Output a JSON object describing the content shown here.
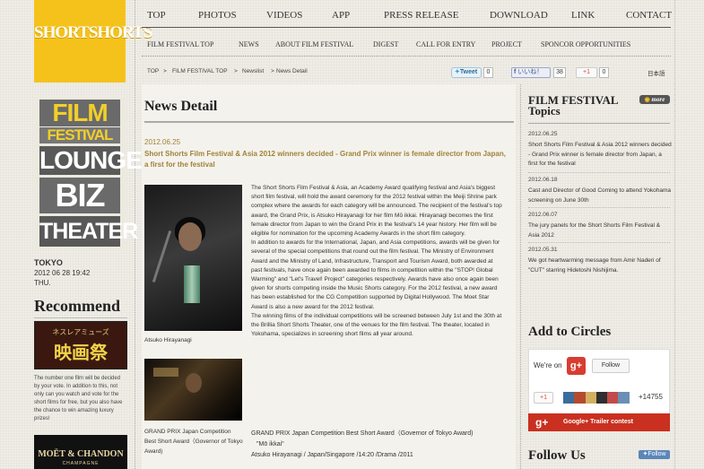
{
  "logo": {
    "text": "SHORTSHORTS"
  },
  "lounge": {
    "words": [
      "FILM",
      "FESTIVAL",
      "LOUNGE",
      "BIZ",
      "THEATER"
    ]
  },
  "location": {
    "city": "TOKYO",
    "datetime": "2012 06 28 19:42",
    "day": "THU."
  },
  "recommend": {
    "title": "Recommend",
    "banner_small": "ネスレアミューズ",
    "banner_big": "映画祭",
    "note": "The number one film will be decided by your vote. In addition to this, not only can you watch and vote for the short films for free, but you also have the chance to win amazing luxury prizes!",
    "moet_name": "MOËT & CHANDON",
    "moet_sub": "CHAMPAGNE"
  },
  "nav": {
    "primary": [
      "TOP",
      "PHOTOS",
      "VIDEOS",
      "APP",
      "PRESS RELEASE",
      "DOWNLOAD",
      "LINK",
      "CONTACT"
    ],
    "secondary": [
      "FILM FESTIVAL TOP",
      "NEWS",
      "ABOUT FILM FESTIVAL",
      "DIGEST",
      "CALL FOR ENTRY",
      "PROJECT",
      "SPONCOR OPPORTUNITIES"
    ]
  },
  "breadcrumb": [
    "TOP",
    "FILM FESTIVAL TOP",
    "Newslist",
    "News Detail"
  ],
  "social": {
    "tweet": "Tweet",
    "tweet_count": "0",
    "like": "いいね！",
    "like_count": "38",
    "plus": "+1",
    "plus_count": "0",
    "lang": "日本語"
  },
  "article": {
    "title": "News Detail",
    "date": "2012.06.25",
    "headline": "Short Shorts Film Festival & Asia 2012 winners decided - Grand Prix winner is female director from Japan, a first for the festival",
    "caption1": "Atsuko Hirayanagi",
    "caption2": "GRAND PRIX Japan Competition Best Short Award（Governor of Tokyo Award)",
    "body": "The Short Shorts Film Festival & Asia, an Academy Award qualifying festival and Asia's biggest short film festival, will hold the award ceremony for the 2012 festival within the Meiji Shrine park complex where the awards for each category will be announced. The recipient of the festival's top award, the Grand Prix, is Atsuko Hirayanagi for her film Mō ikkai. Hirayanagi becomes the first female director from Japan to win the Grand Prix in the festival's 14 year history. Her film will be eligible for nomination for the upcoming Academy Awards in the short film category.\nIn addition to awards for the International, Japan, and Asia competitions, awards will be given for several of the special competitions that round out the film festival. The Ministry of Environment Award and the Ministry of Land, Infrastructure, Transport and Tourism Award, both awarded at past festivals, have once again been awarded to films in competition within the \"STOP! Global Warming\" and \"Let's Travel! Project\" categories respectively. Awards have also once again been given for shorts competing inside the Music Shorts category. For the 2012 festival, a new award has been established for the CG Competition supported by Digital Hollywood. The Moet Star Award is also a new award for the 2012 festival.\nThe winning films of the individual competitions will be screened between July 1st and the 30th at the Brillia Short Shorts Theater, one of the venues for the film festival. The theater, located in Yokohama, specializes in screening short films all year around.",
    "gp_title": "GRAND PRIX Japan Competition Best Short Award（Governor of Tokyo Award)",
    "gp_film": "\"Mō ikkai\"",
    "gp_credit": "Atsuko Hirayanagi / Japan/Singapore /14:20 /Drama /2011"
  },
  "sidebar": {
    "ff_title1": "FILM FESTIVAL",
    "ff_title2": "Topics",
    "more": "more",
    "topics": [
      {
        "date": "2012.06.25",
        "text": "Short Shorts Film Festival & Asia 2012 winners decided - Grand Prix winner is female director from Japan, a first for the festival"
      },
      {
        "date": "2012.06.18",
        "text": "Cast and Director of Good Coming to attend Yokohama screening on June 30th"
      },
      {
        "date": "2012.06.07",
        "text": "The jury panels for the Short Shorts Film Festival & Asia 2012"
      },
      {
        "date": "2012.05.31",
        "text": "We got heartwarming message from Amir Naderi of \"CUT\" starring Hidetoshi Nishijima."
      }
    ],
    "circles_title": "Add to Circles",
    "we_on": "We're on",
    "g_icon": "g+",
    "follow": "Follow",
    "plus1": "+1",
    "count": "+14755",
    "trailer": "Google+ Trailer contest",
    "follow_us": "Follow Us",
    "follow_btn": "Follow"
  }
}
